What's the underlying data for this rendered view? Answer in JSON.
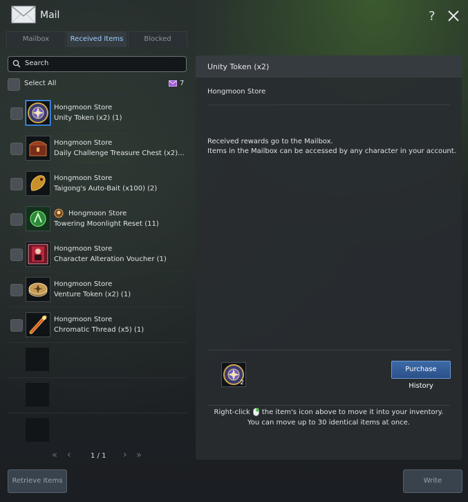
{
  "window": {
    "title": "Mail",
    "help_label": "?"
  },
  "tabs": [
    {
      "label": "Mailbox",
      "active": false
    },
    {
      "label": "Received Items",
      "active": true
    },
    {
      "label": "Blocked",
      "active": false
    }
  ],
  "search": {
    "placeholder": "Search"
  },
  "select_all": {
    "label": "Select All",
    "count": "7"
  },
  "items": [
    {
      "sender": "Hongmoon Store",
      "item": "Unity Token (x2) (1)",
      "icon": "unity-token-icon"
    },
    {
      "sender": "Hongmoon Store",
      "item": "Daily Challenge Treasure Chest (x2)...",
      "icon": "treasure-chest-icon"
    },
    {
      "sender": "Hongmoon Store",
      "item": "Taigong's Auto-Bait (x100) (2)",
      "icon": "fish-bait-icon"
    },
    {
      "sender": "Hongmoon Store",
      "item": "Towering Moonlight Reset (11)",
      "icon": "moonlight-reset-icon"
    },
    {
      "sender": "Hongmoon Store",
      "item": "Character Alteration Voucher (1)",
      "icon": "alteration-voucher-icon"
    },
    {
      "sender": "Hongmoon Store",
      "item": "Venture Token (x2) (1)",
      "icon": "venture-token-icon"
    },
    {
      "sender": "Hongmoon Store",
      "item": "Chromatic Thread (x5) (1)",
      "icon": "chromatic-thread-icon"
    }
  ],
  "pager": {
    "first": "«",
    "prev": "‹",
    "page": "1 / 1",
    "next": "›",
    "last": "»"
  },
  "detail": {
    "title": "Unity Token (x2)",
    "sender": "Hongmoon Store",
    "body_line1": "Received rewards go to the Mailbox.",
    "body_line2": "Items in the Mailbox can be accessed by any character in your account.",
    "attachment_count": "2",
    "purchase_history": "Purchase History",
    "hint_prefix": "Right-click",
    "hint_suffix": "the item's icon above to move it into your inventory.",
    "hint_line2": "You can move up to 30 identical items at once."
  },
  "buttons": {
    "retrieve": "Retrieve Items",
    "write": "Write"
  },
  "colors": {
    "accent": "#5aa7ff",
    "active_tab": "#9fd0ff",
    "purchase_button": "#3b6aa8"
  }
}
